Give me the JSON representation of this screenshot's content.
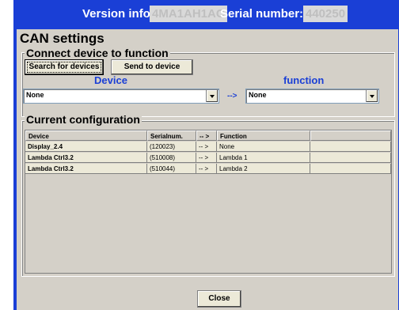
{
  "header": {
    "version_label": "Version info:",
    "version_value": "4MA1AH1AC",
    "serial_label": "Serial number:",
    "serial_value": "440250"
  },
  "can_settings": {
    "title": "CAN settings",
    "connect_group": {
      "title": "Connect device to function",
      "search_button": "Search for devices",
      "send_button": "Send to device",
      "device_label": "Device",
      "function_label": "function",
      "device_value": "None",
      "function_value": "None",
      "arrow": "-->"
    },
    "current_group": {
      "title": "Current configuration",
      "columns": [
        "Device",
        "Serialnum.",
        "-- >",
        "Function",
        ""
      ],
      "rows": [
        [
          "Display_2.4",
          "(120023)",
          "-- >",
          "None",
          ""
        ],
        [
          "Lambda Ctrl3.2",
          "(510008)",
          "-- >",
          "Lambda 1",
          ""
        ],
        [
          "Lambda Ctrl3.2",
          "(510044)",
          "-- >",
          "Lambda 2",
          ""
        ]
      ]
    },
    "close_button": "Close"
  },
  "colors": {
    "window_blue": "#1a3fd6",
    "panel_gray": "#d4d0c8",
    "cell_bg": "#ece9d8"
  }
}
